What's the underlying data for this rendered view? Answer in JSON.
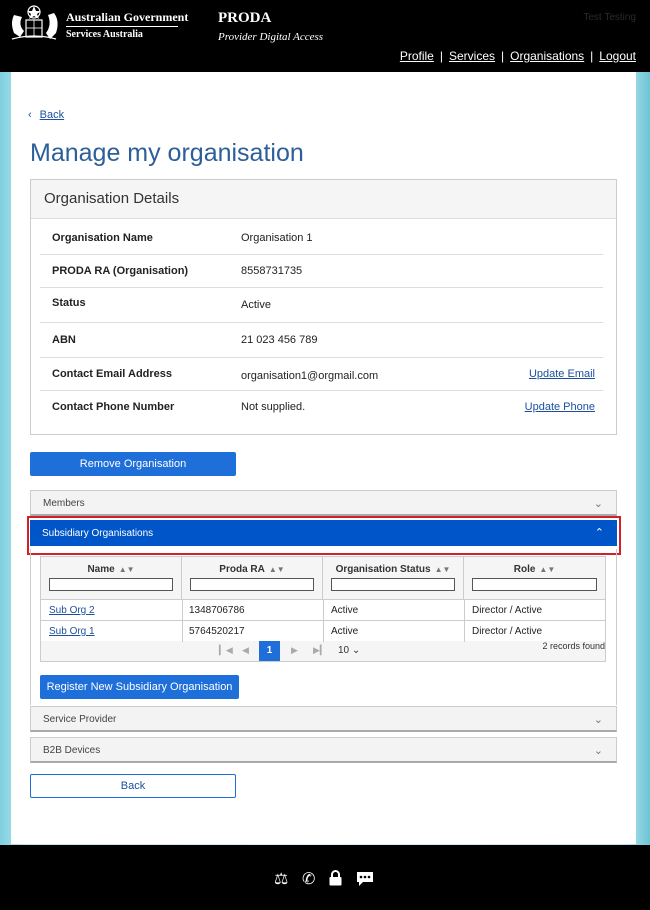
{
  "header": {
    "gov_name": "Australian Government",
    "gov_sub": "Services Australia",
    "app_title": "PRODA",
    "app_subtitle": "Provider Digital Access",
    "user_name": "Test Testing",
    "nav": [
      {
        "label": "Profile"
      },
      {
        "label": "Services"
      },
      {
        "label": "Organisations"
      },
      {
        "label": "Logout"
      }
    ]
  },
  "back_link": "Back",
  "page_title": "Manage my organisation",
  "details": {
    "heading": "Organisation Details",
    "rows": [
      {
        "label": "Organisation Name",
        "value": "Organisation 1",
        "action": ""
      },
      {
        "label": "PRODA RA (Organisation)",
        "value": "8558731735",
        "action": ""
      },
      {
        "label": "Status",
        "value": "Active",
        "action": ""
      },
      {
        "label": "ABN",
        "value": "21 023 456 789",
        "action": ""
      },
      {
        "label": "Contact Email Address",
        "value": "organisation1@orgmail.com",
        "action": "Update Email"
      },
      {
        "label": "Contact Phone Number",
        "value": "Not supplied.",
        "action": "Update Phone"
      }
    ]
  },
  "remove_button": "Remove Organisation",
  "accordion": {
    "members": "Members",
    "subsidiary": "Subsidiary Organisations",
    "service_provider": "Service Provider",
    "b2b": "B2B Devices"
  },
  "table": {
    "columns": [
      "Name",
      "Proda RA",
      "Organisation Status",
      "Role"
    ],
    "rows": [
      {
        "name": "Sub Org 2",
        "proda_ra": "1348706786",
        "status": "Active",
        "role": "Director / Active"
      },
      {
        "name": "Sub Org 1",
        "proda_ra": "5764520217",
        "status": "Active",
        "role": "Director / Active"
      }
    ],
    "pager": {
      "current": "1",
      "page_size": "10",
      "records": "2 records found"
    }
  },
  "register_button": "Register New Subsidiary Organisation",
  "bottom_back_button": "Back",
  "icons": {
    "chevron_down": "chevron-down-icon",
    "chevron_up": "chevron-up-icon",
    "sort": "sort-icon"
  }
}
